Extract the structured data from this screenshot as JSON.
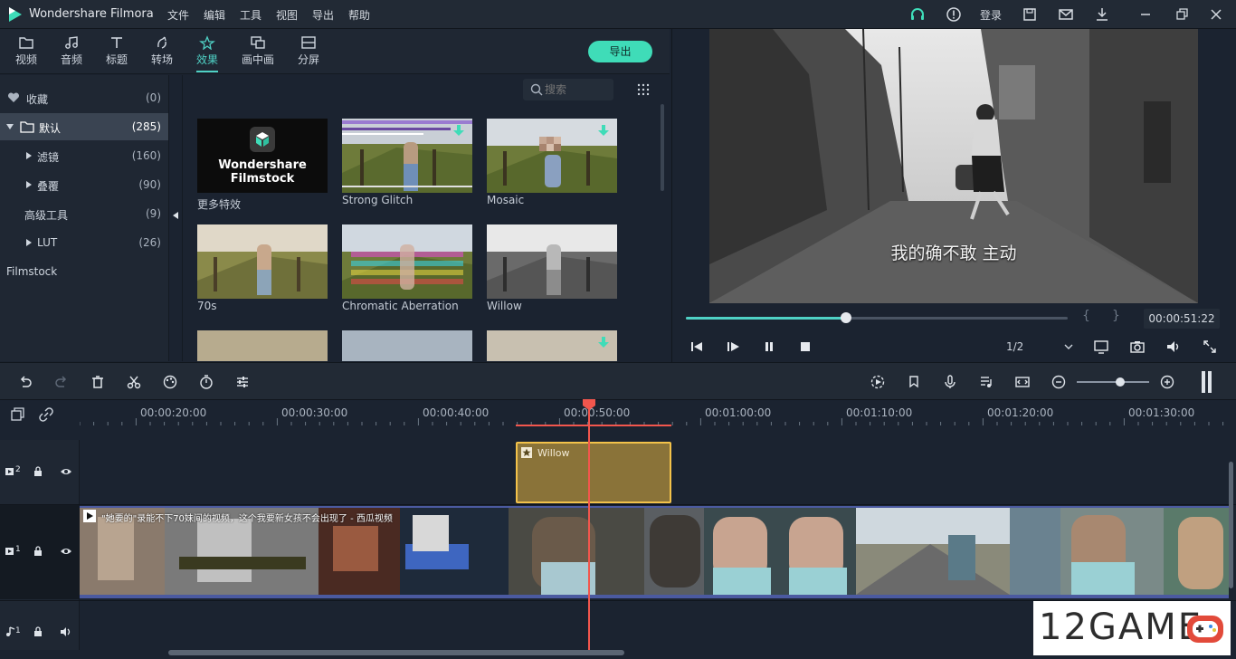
{
  "app": {
    "title": "Wondershare Filmora"
  },
  "menu": [
    "文件",
    "编辑",
    "工具",
    "视图",
    "导出",
    "帮助"
  ],
  "titlebar": {
    "login": "登录"
  },
  "tabs": [
    {
      "label": "视频",
      "icon": "folder-icon"
    },
    {
      "label": "音频",
      "icon": "music-note-icon"
    },
    {
      "label": "标题",
      "icon": "text-t-icon"
    },
    {
      "label": "转场",
      "icon": "transition-icon"
    },
    {
      "label": "效果",
      "icon": "effects-icon",
      "active": true
    },
    {
      "label": "画中画",
      "icon": "pip-icon"
    },
    {
      "label": "分屏",
      "icon": "split-screen-icon"
    }
  ],
  "export_label": "导出",
  "sidebar": {
    "items": [
      {
        "label": "收藏",
        "count": "(0)"
      },
      {
        "label": "默认",
        "count": "(285)",
        "selected": true
      },
      {
        "label": "滤镜",
        "count": "(160)"
      },
      {
        "label": "叠覆",
        "count": "(90)"
      },
      {
        "label": "高级工具",
        "count": "(9)"
      },
      {
        "label": "LUT",
        "count": "(26)"
      },
      {
        "label": "Filmstock",
        "count": ""
      }
    ]
  },
  "search": {
    "placeholder": "搜索"
  },
  "effects": [
    {
      "label": "更多特效",
      "promo_line1": "Wondershare",
      "promo_line2": "Filmstock"
    },
    {
      "label": "Strong Glitch"
    },
    {
      "label": "Mosaic"
    },
    {
      "label": "70s"
    },
    {
      "label": "Chromatic Aberration"
    },
    {
      "label": "Willow"
    }
  ],
  "preview": {
    "subtitle": "我的确不敢  主动",
    "progress": 0.42,
    "timecode": "00:00:51:22",
    "brace_open": "{",
    "brace_close": "}",
    "ratio": "1/2"
  },
  "timeline": {
    "ruler": [
      "00:00:20:00",
      "00:00:30:00",
      "00:00:40:00",
      "00:00:50:00",
      "00:01:00:00",
      "00:01:10:00",
      "00:01:20:00",
      "00:01:30:00"
    ],
    "effect_clip": "Willow",
    "video_clip_title": "\"她要的\"录能不下70妹间的视频，这个我要新女孩不会出现了 - 西瓜视频",
    "tracks": [
      "2",
      "1",
      "1"
    ],
    "zoom": 0.6
  },
  "watermark": "12GAME",
  "colors": {
    "accent": "#4fd1c5",
    "export": "#3fdcb8",
    "playhead": "#f2564d",
    "effect_clip": "#8a7339",
    "video_clip": "#3b4a8a"
  }
}
